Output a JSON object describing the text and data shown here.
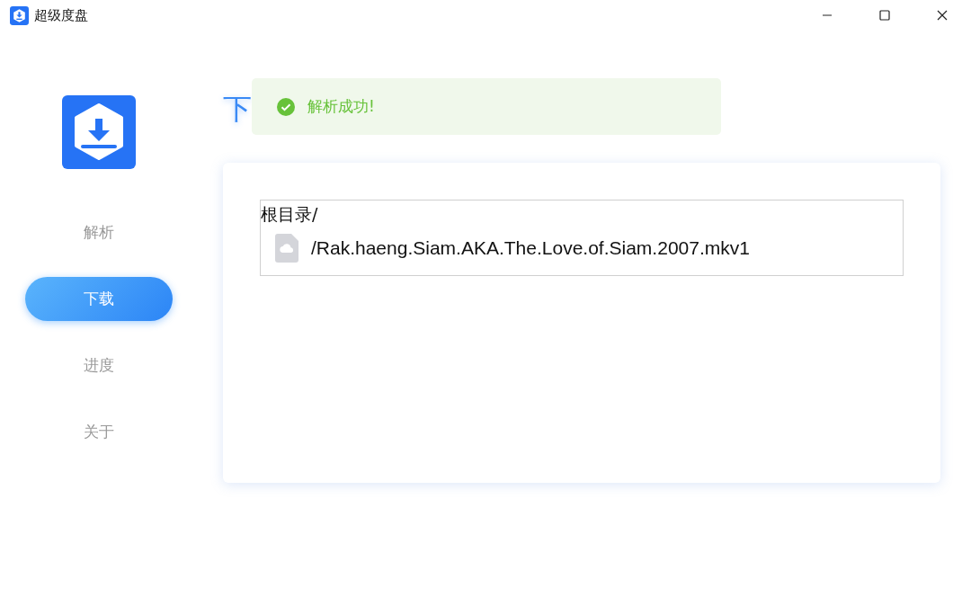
{
  "window": {
    "title": "超级度盘",
    "controls": [
      {
        "kind": "minimize"
      },
      {
        "kind": "maximize"
      },
      {
        "kind": "close"
      }
    ]
  },
  "sidebar": {
    "items": [
      {
        "label": "解析",
        "selected": false
      },
      {
        "label": "下载",
        "selected": true
      },
      {
        "label": "进度",
        "selected": false
      },
      {
        "label": "关于",
        "selected": false
      }
    ]
  },
  "page": {
    "heading": "下"
  },
  "toast": {
    "kind": "success",
    "message": "解析成功!"
  },
  "tree": {
    "label": "根目录/",
    "children": [
      {
        "label": "/Rak.haeng.Siam.AKA.The.Love.of.Siam.2007.mkv1"
      }
    ]
  }
}
